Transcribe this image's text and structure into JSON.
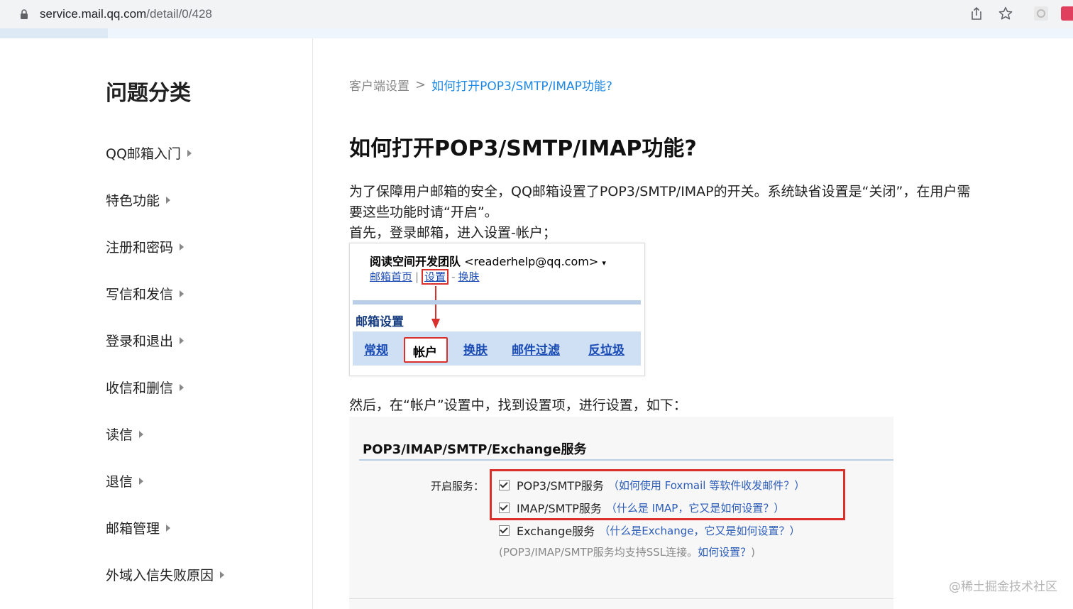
{
  "browser": {
    "url_host": "service.mail.qq.com",
    "url_path": "/detail/0/428"
  },
  "sidebar": {
    "title": "问题分类",
    "items": [
      {
        "label": "QQ邮箱入门"
      },
      {
        "label": "特色功能"
      },
      {
        "label": "注册和密码"
      },
      {
        "label": "写信和发信"
      },
      {
        "label": "登录和退出"
      },
      {
        "label": "收信和删信"
      },
      {
        "label": "读信"
      },
      {
        "label": "退信"
      },
      {
        "label": "邮箱管理"
      },
      {
        "label": "外域入信失败原因"
      }
    ]
  },
  "breadcrumb": {
    "parent": "客户端设置",
    "separator": ">",
    "current": "如何打开POP3/SMTP/IMAP功能?"
  },
  "article": {
    "title": "如何打开POP3/SMTP/IMAP功能?",
    "para1_line1": "为了保障用户邮箱的安全，QQ邮箱设置了POP3/SMTP/IMAP的开关。系统缺省设置是“关闭”，在用户需",
    "para1_line2": "要这些功能时请“开启”。",
    "para2": "首先，登录邮箱，进入设置-帐户；",
    "para3": "然后，在“帐户”设置中，找到设置项，进行设置，如下："
  },
  "image1": {
    "team": "阅读空间开发团队",
    "email": "<readerhelp@qq.com>",
    "caret": "▾",
    "link_home": "邮箱首页",
    "link_settings": "设置",
    "link_skin": "换肤",
    "section_title": "邮箱设置",
    "tabs": [
      "常规",
      "帐户",
      "换肤",
      "邮件过滤",
      "反垃圾"
    ]
  },
  "image2": {
    "header": "POP3/IMAP/SMTP/Exchange服务",
    "label": "开启服务：",
    "rows": [
      {
        "text": "POP3/SMTP服务",
        "hint": "（如何使用 Foxmail 等软件收发邮件？）"
      },
      {
        "text": "IMAP/SMTP服务",
        "hint": "（什么是 IMAP，它又是如何设置？）"
      },
      {
        "text": "Exchange服务",
        "hint": "（什么是Exchange，它又是如何设置？）"
      }
    ],
    "note_prefix": "(POP3/IMAP/SMTP服务均支持SSL连接。",
    "note_link": "如何设置？",
    "note_suffix": ")"
  },
  "watermark": "@稀土掘金技术社区",
  "colors": {
    "link_blue": "#1e88e5",
    "red_highlight": "#d9302c",
    "tab_blue": "#1a4bb4"
  }
}
